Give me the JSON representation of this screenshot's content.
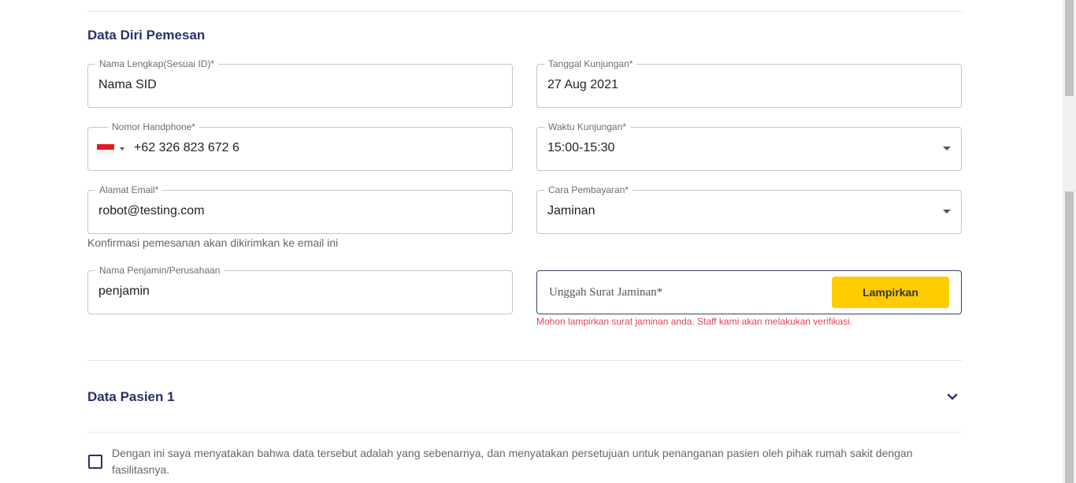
{
  "section": {
    "title": "Data Diri Pemesan"
  },
  "fields": {
    "name": {
      "label": "Nama Lengkap(Sesuai ID)*",
      "value": "Nama SID"
    },
    "phone": {
      "label": "Nomor Handphone*",
      "value": "+62 326 823 672 6",
      "country_flag": "indonesia-flag"
    },
    "email": {
      "label": "Alamat Email*",
      "value": "robot@testing.com",
      "helper": "Konfirmasi pemesanan akan dikirimkan ke email ini"
    },
    "guarantor": {
      "label": "Nama Penjamin/Perusahaan",
      "value": "penjamin"
    },
    "visit_date": {
      "label": "Tanggal Kunjungan*",
      "value": "27 Aug 2021"
    },
    "visit_time": {
      "label": "Waktu Kunjungan*",
      "value": "15:00-15:30"
    },
    "payment": {
      "label": "Cara Pembayaran*",
      "value": "Jaminan"
    }
  },
  "upload": {
    "label": "Unggah Surat Jaminan*",
    "button_label": "Lampirkan",
    "error": "Mohon lampirkan surat jaminan anda. Staff kami akan melakukan verifikasi."
  },
  "patient_section": {
    "title": "Data Pasien 1",
    "icon": "chevron-down-icon"
  },
  "consent": {
    "text": "Dengan ini saya menyatakan bahwa data tersebut adalah yang sebenarnya, dan menyatakan persetujuan untuk penanganan pasien oleh pihak rumah sakit dengan fasilitasnya.",
    "checked": false
  },
  "colors": {
    "heading": "#2b2f6b",
    "accent_button": "#ffcc00",
    "error": "#e0465a",
    "border": "#c4c4c4"
  }
}
